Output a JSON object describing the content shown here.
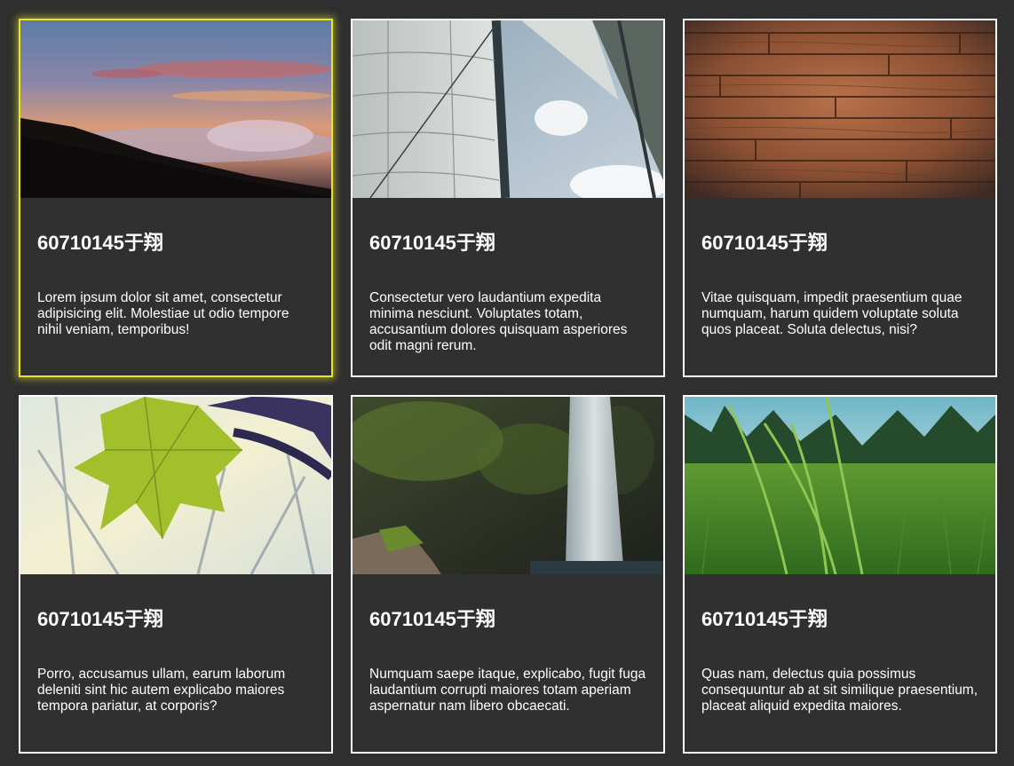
{
  "cards": [
    {
      "title": "60710145于翔",
      "text": "Lorem ipsum dolor sit amet, consectetur adipisicing elit. Molestiae ut odio tempore nihil veniam, temporibus!",
      "image": "sunset-over-clouds-photo",
      "active": true
    },
    {
      "title": "60710145于翔",
      "text": "Consectetur vero laudantium expedita minima nesciunt. Voluptates totam, accusantium dolores quisquam asperiores odit magni rerum.",
      "image": "sailboat-sails-photo",
      "active": false
    },
    {
      "title": "60710145于翔",
      "text": "Vitae quisquam, impedit praesentium quae numquam, harum quidem voluptate soluta quos placeat. Soluta delectus, nisi?",
      "image": "wood-planks-photo",
      "active": false
    },
    {
      "title": "60710145于翔",
      "text": "Porro, accusamus ullam, earum laborum deleniti sint hic autem explicabo maiores tempora pariatur, at corporis?",
      "image": "green-leaf-photo",
      "active": false
    },
    {
      "title": "60710145于翔",
      "text": "Numquam saepe itaque, explicabo, fugit fuga laudantium corrupti maiores totam aperiam aspernatur nam libero obcaecati.",
      "image": "waterfall-photo",
      "active": false
    },
    {
      "title": "60710145于翔",
      "text": "Quas nam, delectus quia possimus consequuntur ab at sit similique praesentium, placeat aliquid expedita maiores.",
      "image": "grass-field-photo",
      "active": false
    }
  ],
  "colors": {
    "page_background": "#2f2f2f",
    "card_border": "#ffffff",
    "active_border": "#e6e62a",
    "text": "#ffffff"
  }
}
